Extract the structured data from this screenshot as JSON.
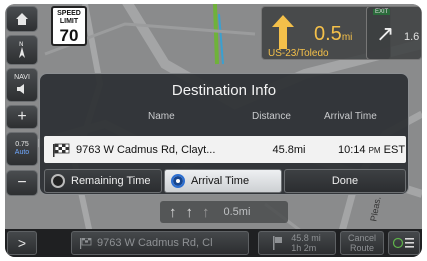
{
  "map": {
    "speed_limit": {
      "top": "SPEED LIMIT",
      "value": "70"
    },
    "next_turn": {
      "distance": "0.5",
      "unit": "mi",
      "road": "US-23/Toledo"
    },
    "exit": {
      "label": "EXIT",
      "distance": "1.6"
    },
    "rail": {
      "navi": "NAVI",
      "scale": "0.75",
      "auto": "Auto"
    },
    "street_label": "Pleas."
  },
  "dialog": {
    "title": "Destination Info",
    "columns": {
      "name": "Name",
      "distance": "Distance",
      "arrival": "Arrival Time"
    },
    "row": {
      "name": "9763 W Cadmus Rd, Clayt...",
      "distance": "45.8mi",
      "time": "10:14",
      "ampm": "PM",
      "tz": "EST"
    },
    "options": {
      "remaining": "Remaining Time",
      "arrival": "Arrival Time",
      "done": "Done"
    }
  },
  "lanes": {
    "distance": "0.5mi"
  },
  "bottom": {
    "menu": ">",
    "destination": "9763 W Cadmus Rd, Cl",
    "distance": "45.8 mi",
    "time": "1h 2m",
    "cancel_line1": "Cancel",
    "cancel_line2": "Route"
  },
  "colors": {
    "turn_text": "#f4c04a",
    "selected_radio": "#2d6fd0",
    "dialog_bg": "#303336"
  }
}
